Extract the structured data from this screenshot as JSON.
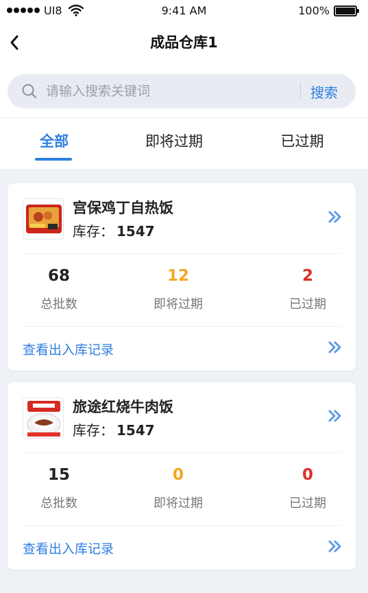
{
  "status_bar": {
    "carrier": "UI8",
    "time": "9:41 AM",
    "battery": "100%"
  },
  "nav": {
    "title": "成品仓库1"
  },
  "search": {
    "placeholder": "请输入搜索关键词",
    "button": "搜索"
  },
  "tabs": [
    {
      "label": "全部",
      "active": true
    },
    {
      "label": "即将过期",
      "active": false
    },
    {
      "label": "已过期",
      "active": false
    }
  ],
  "products": [
    {
      "name": "宫保鸡丁自热饭",
      "stock_label": "库存：",
      "stock": "1547",
      "stats": [
        {
          "value": "68",
          "label": "总批数"
        },
        {
          "value": "12",
          "label": "即将过期"
        },
        {
          "value": "2",
          "label": "已过期"
        }
      ],
      "link": "查看出入库记录"
    },
    {
      "name": "旅途红烧牛肉饭",
      "stock_label": "库存：",
      "stock": "1547",
      "stats": [
        {
          "value": "15",
          "label": "总批数"
        },
        {
          "value": "0",
          "label": "即将过期"
        },
        {
          "value": "0",
          "label": "已过期"
        }
      ],
      "link": "查看出入库记录"
    }
  ],
  "colors": {
    "accent": "#2d7fe0",
    "warning": "#f5a623",
    "danger": "#d9302b"
  }
}
